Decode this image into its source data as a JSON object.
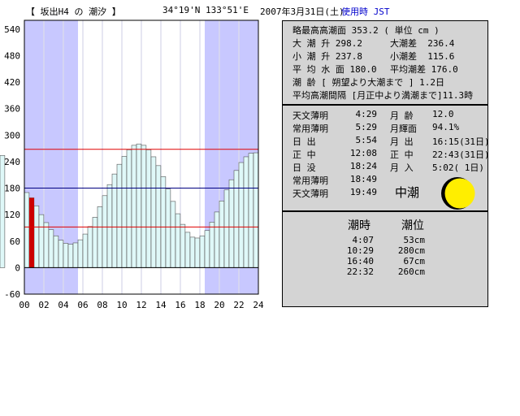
{
  "header": {
    "title": "【 坂出H4 の 潮汐 】",
    "coords": "34°19'N  133°51'E",
    "date": "2007年3月31日(土)",
    "tz": "使用時 JST"
  },
  "colors": {
    "night": "#c8c8ff",
    "bar_fill": "#dff8f8",
    "current_bar": "#cc0000",
    "red_line": "#e00000",
    "blue_line": "#000080"
  },
  "chart_data": {
    "type": "bar",
    "title": "",
    "xlabel": "",
    "ylabel": "",
    "x_ticks": [
      "00",
      "02",
      "04",
      "06",
      "08",
      "10",
      "12",
      "14",
      "16",
      "18",
      "20",
      "22",
      "24"
    ],
    "y_ticks": [
      "540",
      "480",
      "420",
      "360",
      "300",
      "240",
      "180",
      "120",
      "60",
      "0",
      "-60"
    ],
    "ylim": [
      -60,
      560
    ],
    "xlim": [
      0,
      24
    ],
    "night_ranges": [
      [
        0,
        5.5
      ],
      [
        18.5,
        24
      ]
    ],
    "reference_lines": [
      {
        "value": 268,
        "color": "#e00000"
      },
      {
        "value": 180,
        "color": "#000080"
      },
      {
        "value": 92,
        "color": "#e00000"
      }
    ],
    "current_bar_x": [
      0.5,
      1.0
    ],
    "x": [
      0,
      0.5,
      1,
      1.5,
      2,
      2.5,
      3,
      3.5,
      4,
      4.5,
      5,
      5.5,
      6,
      6.5,
      7,
      7.5,
      8,
      8.5,
      9,
      9.5,
      10,
      10.5,
      11,
      11.5,
      12,
      12.5,
      13,
      13.5,
      14,
      14.5,
      15,
      15.5,
      16,
      16.5,
      17,
      17.5,
      18,
      18.5,
      19,
      19.5,
      20,
      20.5,
      21,
      21.5,
      22,
      22.5,
      23,
      23.5
    ],
    "values": [
      170,
      158,
      140,
      120,
      102,
      86,
      72,
      62,
      55,
      53,
      56,
      63,
      76,
      93,
      114,
      138,
      163,
      188,
      212,
      234,
      252,
      267,
      277,
      280,
      277,
      267,
      251,
      231,
      206,
      178,
      150,
      122,
      98,
      80,
      69,
      67,
      72,
      84,
      103,
      126,
      151,
      176,
      199,
      220,
      238,
      251,
      259,
      260,
      254
    ]
  },
  "info": {
    "rows": [
      {
        "label": "略最高高潮面",
        "value": "353.2   ( 単位 cm )"
      },
      {
        "label": "大   潮   升",
        "value": "298.2",
        "label2": "大潮差",
        "value2": "236.4"
      },
      {
        "label": "小   潮   升",
        "value": "237.8",
        "label2": "小潮差",
        "value2": "115.6"
      },
      {
        "label": "平 均  水 面",
        "value": "180.0",
        "label2": "平均潮差",
        "value2": "176.0"
      },
      {
        "label": "潮       齢 [ 朔望より大潮まで ] 1.2日"
      },
      {
        "label": "平均高潮間隔 [月正中より満潮まで]11.3時"
      }
    ]
  },
  "astro": {
    "left": [
      {
        "label": "天文薄明",
        "value": "4:29"
      },
      {
        "label": "常用薄明",
        "value": "5:29"
      },
      {
        "label": "日   出",
        "value": "5:54"
      },
      {
        "label": "正   中",
        "value": "12:08"
      },
      {
        "label": "日   没",
        "value": "18:24"
      },
      {
        "label": "常用薄明",
        "value": "18:49"
      },
      {
        "label": "天文薄明",
        "value": "19:49"
      }
    ],
    "right": [
      {
        "label": "月   齢",
        "value": "12.0"
      },
      {
        "label": "月輝面",
        "value": "94.1%"
      },
      {
        "label": "月   出",
        "value": "16:15(31日)"
      },
      {
        "label": "正   中",
        "value": "22:43(31日)"
      },
      {
        "label": "月   入",
        "value": "5:02( 1日)"
      }
    ],
    "phase": "中潮"
  },
  "tides": {
    "header_time": "潮時",
    "header_level": "潮位",
    "rows": [
      {
        "time": "4:07",
        "level": "53cm"
      },
      {
        "time": "10:29",
        "level": "280cm"
      },
      {
        "time": "16:40",
        "level": "67cm"
      },
      {
        "time": "22:32",
        "level": "260cm"
      }
    ]
  }
}
